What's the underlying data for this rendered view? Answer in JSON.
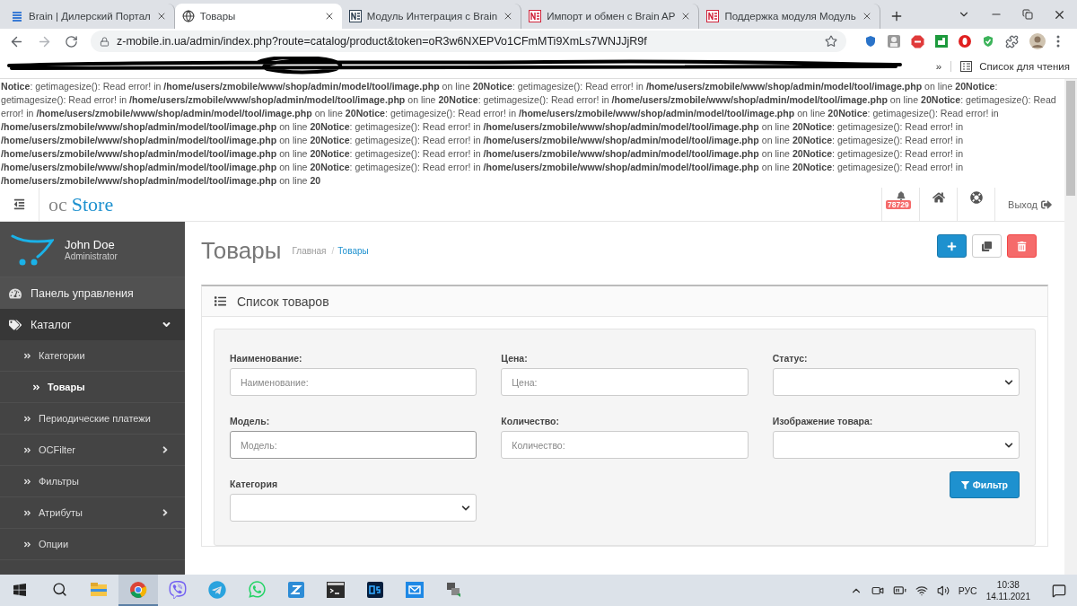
{
  "browser": {
    "tabs": [
      {
        "title": "Brain | Дилерский Портал",
        "selected": false
      },
      {
        "title": "Товары",
        "selected": true
      },
      {
        "title": "Модуль Интеграция с Brain",
        "selected": false
      },
      {
        "title": "Импорт и обмен с Brain AP",
        "selected": false
      },
      {
        "title": "Поддержка модуля Модуль",
        "selected": false
      }
    ],
    "url": "z-mobile.in.ua/admin/index.php?route=catalog/product&token=oR3w6NXEPVo1CFmMTi9XmLs7WNJJjR9f",
    "bookmarks": {
      "overflow": "»",
      "reading_list": "Список для чтения"
    }
  },
  "notices": [
    "**Notice**: getimagesize(): Read error! in **/home/users/zmobile/www/shop/admin/model/tool/image.php** on line **20**",
    "**Notice**: getimagesize(): Read error! in **/home/users/zmobile/www/shop/admin/model/tool/image.php** on line **20**",
    "**Notice**: getimagesize(): Read error! in **/home/users/zmobile/www/shop/admin/model/tool/image.php** on line **20**",
    "**Notice**: getimagesize(): Read error! in **/home/users/zmobile/www/shop/admin/model/tool/image.php** on line **20**",
    "**Notice**: getimagesize(): Read error! in **/home/users/zmobile/www/shop/admin/model/tool/image.php** on line **20**",
    "**Notice**: getimagesize(): Read error! in **/home/users/zmobile/www/shop/admin/model/tool/image.php** on line **20**",
    "**Notice**: getimagesize(): Read error! in **/home/users/zmobile/www/shop/admin/model/tool/image.php** on line **20**",
    "**Notice**: getimagesize(): Read error! in **/home/users/zmobile/www/shop/admin/model/tool/image.php** on line **20**",
    "**Notice**: getimagesize(): Read error! in **/home/users/zmobile/www/shop/admin/model/tool/image.php** on line **20**",
    "**Notice**: getimagesize(): Read error! in **/home/users/zmobile/www/shop/admin/model/tool/image.php** on line **20**",
    "**Notice**: getimagesize(): Read error! in **/home/users/zmobile/www/shop/admin/model/tool/image.php** on line **20**",
    "**Notice**: getimagesize(): Read error! in **/home/users/zmobile/www/shop/admin/model/tool/image.php** on line **20**",
    "**Notice**: getimagesize(): Read error! in **/home/users/zmobile/www/shop/admin/model/tool/image.php** on line **20**",
    "**Notice**: getimagesize(): Read error! in **/home/users/zmobile/www/shop/admin/model/tool/image.php** on line **20**",
    "**Notice**: getimagesize(): Read error! in **/home/users/zmobile/www/shop/admin/model/tool/image.php** on line **20**"
  ],
  "header": {
    "logo_prefix": "oc",
    "logo_name": "Store",
    "notification_count": "78729",
    "logout": "Выход"
  },
  "sidebar": {
    "user": {
      "name": "John Doe",
      "role": "Administrator"
    },
    "menu": [
      {
        "label": "Панель управления",
        "kind": "link"
      },
      {
        "label": "Каталог",
        "kind": "group",
        "expanded": true,
        "children": [
          {
            "label": "Категории",
            "kind": "link",
            "selected": false
          },
          {
            "label": "Товары",
            "kind": "link",
            "selected": true
          },
          {
            "label": "Периодические платежи",
            "kind": "link",
            "selected": false
          },
          {
            "label": "OCFilter",
            "kind": "group",
            "expanded": false,
            "selected": false
          },
          {
            "label": "Фильтры",
            "kind": "link",
            "selected": false
          },
          {
            "label": "Атрибуты",
            "kind": "group",
            "expanded": false,
            "selected": false
          },
          {
            "label": "Опции",
            "kind": "link",
            "selected": false
          }
        ]
      }
    ]
  },
  "page": {
    "title": "Товары",
    "breadcrumb": [
      {
        "label": "Главная",
        "selected": false
      },
      {
        "label": "Товары",
        "selected": true,
        "separator": "/"
      }
    ],
    "actions": [
      {
        "kind": "add"
      },
      {
        "kind": "copy"
      },
      {
        "kind": "delete"
      }
    ],
    "panel": {
      "title": "Список товаров",
      "fields": [
        {
          "label": "Наименование:",
          "kind": "input",
          "placeholder": "Наименование:",
          "focused": false
        },
        {
          "label": "Цена:",
          "kind": "input",
          "placeholder": "Цена:",
          "focused": false
        },
        {
          "label": "Статус:",
          "kind": "select",
          "focused": false
        },
        {
          "label": "Модель:",
          "kind": "input",
          "placeholder": "Модель:",
          "focused": true
        },
        {
          "label": "Количество:",
          "kind": "input",
          "placeholder": "Количество:",
          "focused": false
        },
        {
          "label": "Изображение товара:",
          "kind": "select",
          "focused": false
        },
        {
          "label": "Категория",
          "kind": "select",
          "focused": false
        }
      ],
      "filter_button": "Фильтр"
    }
  },
  "taskbar": {
    "apps": [
      {
        "kind": "explorer",
        "selected": false
      },
      {
        "kind": "chrome",
        "selected": true
      },
      {
        "kind": "viber",
        "selected": false
      },
      {
        "kind": "telegram",
        "selected": false
      },
      {
        "kind": "whatsapp",
        "selected": false
      },
      {
        "kind": "zapp",
        "selected": false
      },
      {
        "kind": "terminal",
        "selected": false
      },
      {
        "kind": "photoshop",
        "selected": false
      },
      {
        "kind": "mail",
        "selected": false
      },
      {
        "kind": "network",
        "selected": false
      }
    ],
    "language": "РУС",
    "time": "10:38",
    "date": "14.11.2021"
  }
}
